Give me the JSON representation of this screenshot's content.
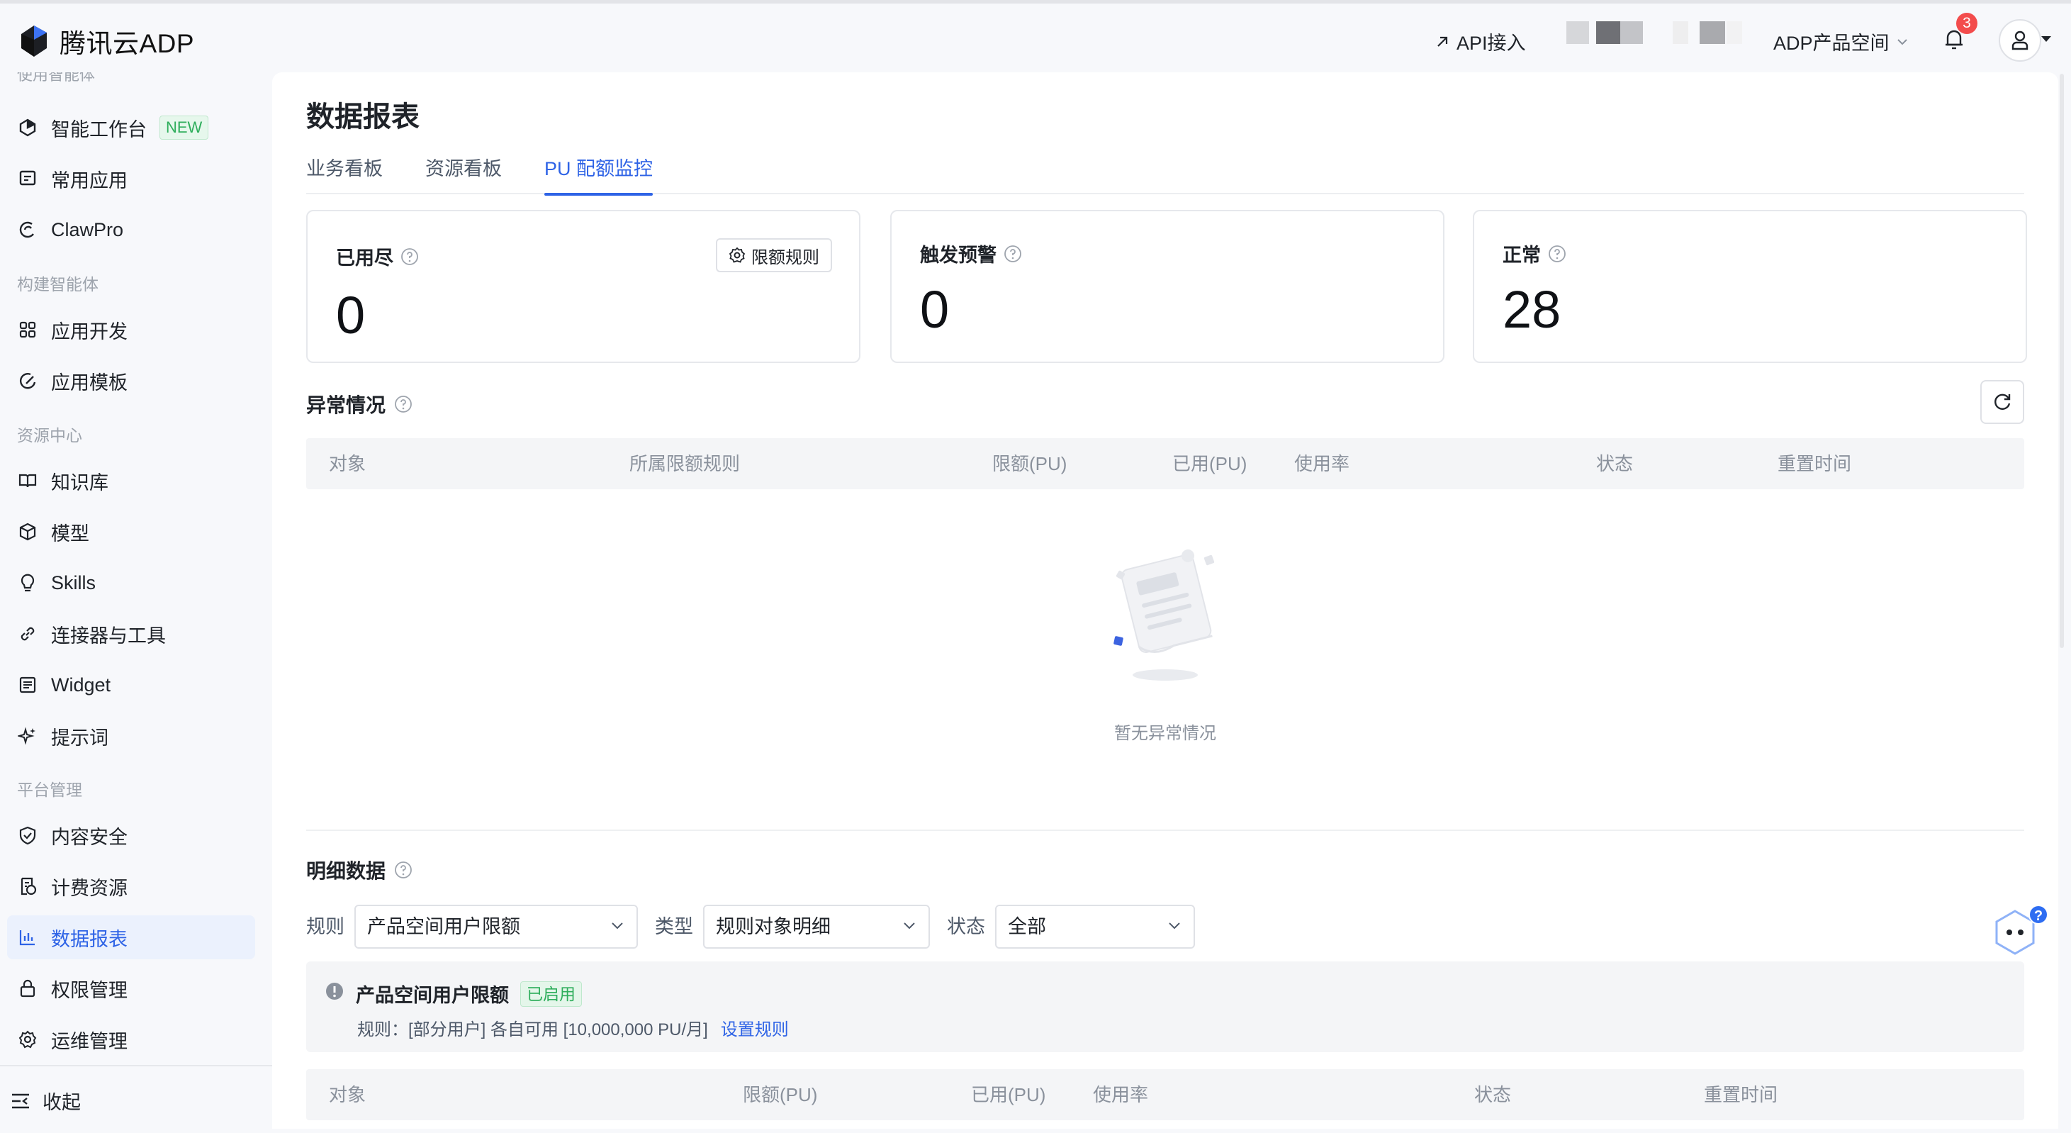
{
  "brand": {
    "name": "腾讯云ADP"
  },
  "header": {
    "api_label": "API接入",
    "space_label": "ADP产品空间",
    "notification_count": "3"
  },
  "sidebar": {
    "cut_group": "使用智能体",
    "items": [
      {
        "label": "智能工作台",
        "tag": "NEW",
        "icon": "workbench-icon"
      },
      {
        "label": "常用应用",
        "icon": "chat-icon"
      },
      {
        "label": "ClawPro",
        "icon": "claw-icon"
      }
    ],
    "group_build": "构建智能体",
    "build_items": [
      {
        "label": "应用开发",
        "icon": "grid-icon"
      },
      {
        "label": "应用模板",
        "icon": "template-icon"
      }
    ],
    "group_resource": "资源中心",
    "resource_items": [
      {
        "label": "知识库",
        "icon": "book-icon"
      },
      {
        "label": "模型",
        "icon": "cube-icon"
      },
      {
        "label": "Skills",
        "icon": "bulb-icon"
      },
      {
        "label": "连接器与工具",
        "icon": "link-icon"
      },
      {
        "label": "Widget",
        "icon": "widget-icon"
      },
      {
        "label": "提示词",
        "icon": "sparkle-icon"
      }
    ],
    "group_platform": "平台管理",
    "platform_items": [
      {
        "label": "内容安全",
        "icon": "shield-icon"
      },
      {
        "label": "计费资源",
        "icon": "billing-icon"
      },
      {
        "label": "数据报表",
        "icon": "chart-icon",
        "active": true
      },
      {
        "label": "权限管理",
        "icon": "lock-icon"
      },
      {
        "label": "运维管理",
        "icon": "gear-icon"
      }
    ],
    "collapse_label": "收起"
  },
  "page": {
    "title": "数据报表",
    "tabs": [
      "业务看板",
      "资源看板",
      "PU 配额监控"
    ],
    "active_tab": "PU 配额监控"
  },
  "stats": [
    {
      "label": "已用尽",
      "value": "0"
    },
    {
      "label": "触发预警",
      "value": "0"
    },
    {
      "label": "正常",
      "value": "28"
    }
  ],
  "rule_button": "限额规则",
  "anomaly": {
    "title": "异常情况",
    "columns": [
      "对象",
      "所属限额规则",
      "限额(PU)",
      "已用(PU)",
      "使用率",
      "状态",
      "重置时间"
    ],
    "empty_text": "暂无异常情况"
  },
  "detail": {
    "title": "明细数据",
    "filters": [
      {
        "label": "规则",
        "value": "产品空间用户限额"
      },
      {
        "label": "类型",
        "value": "规则对象明细"
      },
      {
        "label": "状态",
        "value": "全部"
      }
    ],
    "notice": {
      "title": "产品空间用户限额",
      "status": "已启用",
      "rule_text": "规则：[部分用户] 各自可用 [10,000,000 PU/月]",
      "link": "设置规则"
    },
    "columns": [
      "对象",
      "限额(PU)",
      "已用(PU)",
      "使用率",
      "状态",
      "重置时间"
    ]
  },
  "colors": {
    "accent": "#2e63e6",
    "success": "#2fae5c",
    "badge": "#f34c4c"
  }
}
